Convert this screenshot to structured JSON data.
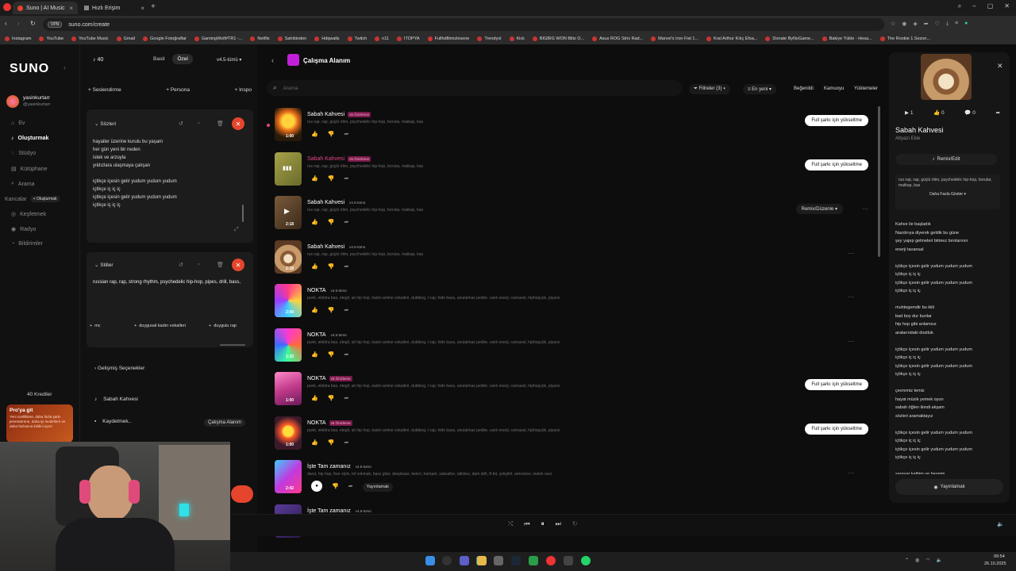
{
  "browser": {
    "tabs": [
      {
        "label": "Suno | AI Music"
      },
      {
        "label": "Hızlı Erişim"
      }
    ],
    "url": "suno.com/create",
    "vpn": "VPN",
    "bookmarks": [
      "Instagram",
      "YouTube",
      "YouTube Music",
      "Gmail",
      "Google Fotoğraflar",
      "GamingWolf#TR1 -...",
      "Netflix",
      "Sahibinden",
      "Hdqwalls",
      "Twitch",
      "n11",
      "ITOPYA",
      "Fullhdfilmizlesene",
      "Trendyol",
      "Kick",
      "BIGBIG WON Blitz O...",
      "Asus ROG Strix Rad...",
      "Marvel's Iron Fist 1...",
      "Kral Arthur Kılıç Efsa...",
      "Donate ByNoGame...",
      "Bakiye Yükle - Hesa...",
      "The Rookie 1.Sezon..."
    ]
  },
  "sidebar": {
    "logo": "SUNO",
    "user": {
      "name": "yasinkurtarr",
      "handle": "@yasinkurtarr"
    },
    "items": [
      {
        "label": "Ev"
      },
      {
        "label": "Oluşturmak"
      },
      {
        "label": "Stüdyo"
      },
      {
        "label": "Kütüphane"
      },
      {
        "label": "Arama"
      },
      {
        "label": "Kancalar"
      },
      {
        "label": "Keşfetmek"
      },
      {
        "label": "Radyo"
      },
      {
        "label": "Bildirimler"
      }
    ],
    "kancalar_badge": "+ Oluşturmak",
    "credits": "40 Krediler",
    "promo": {
      "title": "Pro'ya git",
      "text": "Yeni özelliklere, daha fazla şarkı jeneratörüne, daha iyi modellere ve daha fazlasına kilidini açın!"
    }
  },
  "create": {
    "credits": "40",
    "modes": [
      "Basit",
      "Özel"
    ],
    "version": "v4.5-tümü",
    "actions": [
      "Seslendirme",
      "Persona",
      "Inspo"
    ],
    "lyrics_label": "Sözleri",
    "lyrics": "hayaller üzerine kurulu bu yaşam\nher gün yeni bir neden\nistek ve arzuyla\nyıldızlara ulaşmaya çalışan\n\niçtikçe içesin gelir yudum yudum yudum\niçtikçe iç iç iç\niçtikçe içesin gelir yudum yudum yudum\niçtikçe iç iç iç",
    "styles_label": "Stiller",
    "styles": "russian rap, rap, strong rhythm, psychedelic hip-hop, pipes, drill, bass,",
    "style_chips": [
      "mc",
      "duygusal kadın vokalleri",
      "duygulu rap"
    ],
    "advanced": "Gelişmiş Seçenekler",
    "song_title": "Sabah Kahvesi",
    "save_label": "Kaydetmek..",
    "workspace_btn": "Çalışma Alanım"
  },
  "workspace": {
    "title": "Çalışma Alanım",
    "search_placeholder": "Arama",
    "filters": "Filtreler (3)",
    "sort": "En yeni",
    "liked": "Beğenildi",
    "public": "Kamuoyu",
    "uploads": "Yüklemeler",
    "upgrade_label": "Full şarkı için yükseltme",
    "remix_label": "Remix/Düzenle",
    "publish_label": "Yayınlamak",
    "songs": [
      {
        "title": "Sabah Kahvesi",
        "badge": "v5 Önizleme",
        "pink": true,
        "tags": "rus rap, rap, güçlü ritim, psychedelic hip-hop, borular, matkap, bas",
        "duration": "1:00",
        "upgrade": true
      },
      {
        "title": "Sabah Kahvesi",
        "badge": "v5 Önizleme",
        "pink": true,
        "tags": "rus rap, rap, güçlü ritim, psychedelic hip-hop, borular, matkap, bas",
        "duration": "",
        "upgrade": true
      },
      {
        "title": "Sabah Kahvesi",
        "badge": "v4.5-tümü",
        "pink": false,
        "tags": "rus rap, rap, güçlü ritim, psychedelic hip-hop, borular, matkap, bas",
        "duration": "2:18",
        "remix": true
      },
      {
        "title": "Sabah Kahvesi",
        "badge": "v4.5-tümü",
        "pink": false,
        "tags": "rus rap, rap, güçlü ritim, psychedelic hip-hop, borular, matkap, bas",
        "duration": "2:18"
      },
      {
        "title": "NOKTA",
        "badge": "v4.5-tümü",
        "pink": false,
        "tags": "punk, elektra bas, etegil, uk hip hop, kadın anime vokalleri, dubbing, t rap, hide bass, unutulmaz pedler, canlı enerji, carnaval, hiphopçük, piyano",
        "duration": "2:09"
      },
      {
        "title": "NOKTA",
        "badge": "v4.5-tümü",
        "pink": false,
        "tags": "punk, elektra bas, etegil, uk hip hop, kadın anime vokalleri, dubbing, t rap, hide bass, unutulmaz pedler, canlı enerji, carnaval, hiphopçük, piyano",
        "duration": "1:33"
      },
      {
        "title": "NOKTA",
        "badge": "v5 Önizleme",
        "pink": true,
        "tags": "punk, elektra bas, etegil, uk hip hop, kadın anime vokalleri, dubbing, t rap, hide bass, unutulmaz pedler, canlı enerji, carnaval, hiphopçük, piyano",
        "duration": "1:00",
        "upgrade": true
      },
      {
        "title": "NOKTA",
        "badge": "v5 Önizleme",
        "pink": true,
        "tags": "punk, elektra bas, etegil, uk hip hop, kadın anime vokalleri, dubbing, t rap, hide bass, unutulmaz pedler, canlı enerji, carnaval, hiphopçük, piyano",
        "duration": "1:00",
        "upgrade": true
      },
      {
        "title": "İşte Tam zamanız",
        "badge": "v4.5-tümü",
        "pink": false,
        "tags": "darul, hip hop, free style, lof sokmak, bass gitar, deepbass, beleri, trampet, saksafon, talkbox, dark drill, 8-bit, çeliştirli, armonize, melek sesi",
        "duration": "2:42",
        "publish": true
      },
      {
        "title": "İşte Tam zamanız",
        "badge": "v4.5-tümü",
        "pink": false,
        "tags": "",
        "duration": ""
      }
    ]
  },
  "detail": {
    "plays": "1",
    "likes": "0",
    "comments": "0",
    "title": "Sabah Kahvesi",
    "subtitle": "Altyazı Ekle",
    "remix": "Remix/Edit",
    "tags": "rus rap, rap, güçlü ritim, psychedelic hip-hop, borular, matkap, bas",
    "show_more": "Daha Fazla Göster",
    "lyrics": "Kahve ile başladık\nNazdırıya diyerek geldik bu güne\nşey yapıp gelmeleri bitmez bırolarının\nenerji tavansal\n\niçtikçe içesin gelir yudum yudum yudum\niçtikçe iç iç iç\niçtikçe içesin gelir yudum yudum yudum\niçtikçe iç iç iç\n\nmuhtegemdir bu ikili\nbad boy dur bunlar\nhip hop gibi anlamsız\naralarındaki dostluk\n\niçtikçe içesin gelir yudum yudum yudum\niçtikçe iç iç iç\niçtikçe içesin gelir yudum yudum yudum\niçtikçe iç iç iç\n\nçevremiz temiz\nhayat müzik yemek oyun\nsabah öğlen ikindi akşam\nsözleri aramaktayız\n\niçtikçe içesin gelir yudum yudum yudum\niçtikçe iç iç iç\niçtikçe içesin gelir yudum yudum yudum\niçtikçe iç iç iç\n\nsaravar kalbim ve beynim",
    "publish": "Yayınlamak"
  },
  "taskbar": {
    "time": "09:54",
    "date": "26.10.2025"
  },
  "colors": {
    "accent": "#e5452c",
    "pink": "#d6249f",
    "bg": "#0d0d0d"
  }
}
